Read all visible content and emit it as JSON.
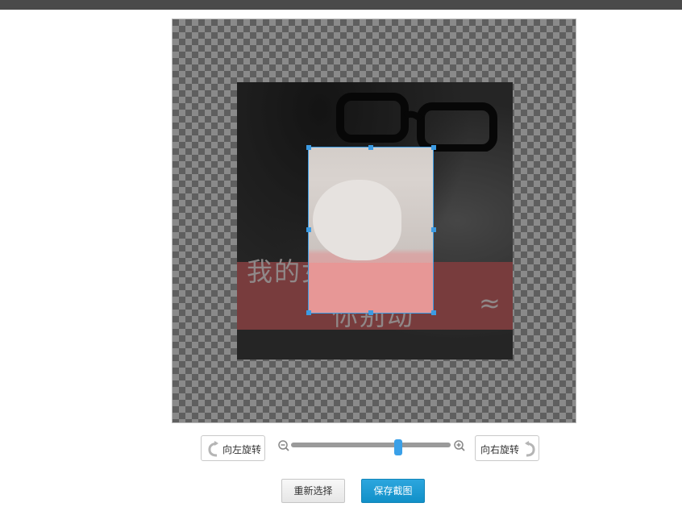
{
  "controls": {
    "rotate_left_label": "向左旋转",
    "rotate_right_label": "向右旋转",
    "zoom_level": 0.67
  },
  "actions": {
    "reset_label": "重新选择",
    "save_label": "保存截图"
  },
  "photo": {
    "overlay_text_line1": "我的女人",
    "overlay_text_line2": "你别动",
    "overlay_text_symbol": "≈"
  },
  "colors": {
    "accent": "#3c9be3",
    "save_button": "#1a98d2",
    "slider_track": "#9a9a9a"
  }
}
